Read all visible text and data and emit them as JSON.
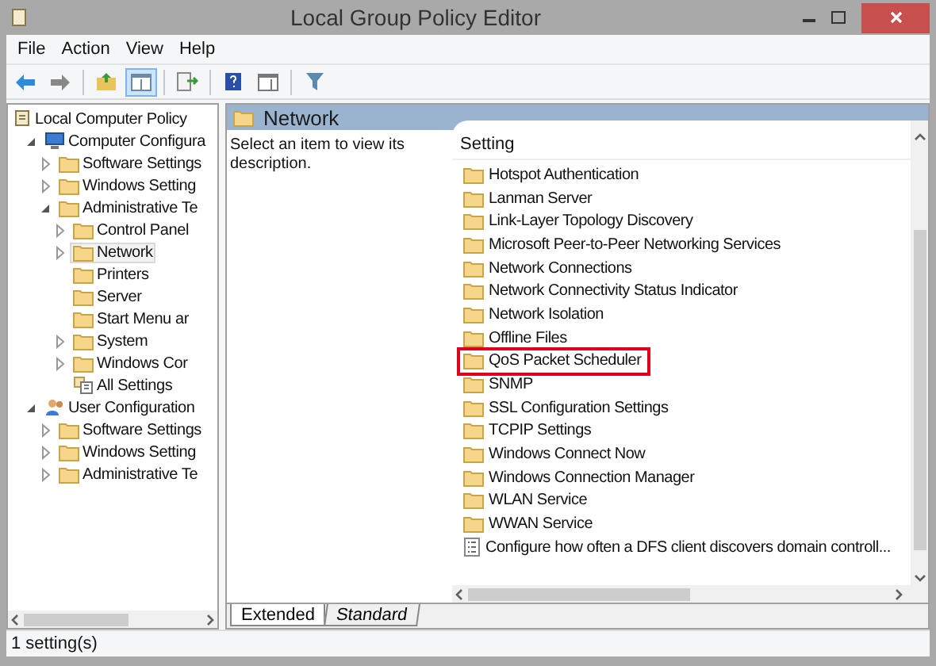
{
  "window": {
    "title": "Local Group Policy Editor"
  },
  "menu": [
    "File",
    "Action",
    "View",
    "Help"
  ],
  "toolbar": [
    {
      "kind": "back",
      "selected": false
    },
    {
      "kind": "forward",
      "selected": false
    },
    {
      "kind": "sep"
    },
    {
      "kind": "up",
      "selected": false
    },
    {
      "kind": "pane",
      "selected": true
    },
    {
      "kind": "sep"
    },
    {
      "kind": "export",
      "selected": false
    },
    {
      "kind": "sep"
    },
    {
      "kind": "help",
      "selected": false
    },
    {
      "kind": "pane2",
      "selected": false
    },
    {
      "kind": "sep"
    },
    {
      "kind": "filter",
      "selected": false
    }
  ],
  "tree": [
    {
      "label": "Local Computer Policy",
      "kind": "policy",
      "selected": false,
      "children": [
        {
          "label": "Computer Configura",
          "kind": "computer",
          "expanded": true,
          "selected": false,
          "children": [
            {
              "label": "Software Settings",
              "kind": "folder",
              "expanded": false,
              "selected": false
            },
            {
              "label": "Windows Setting",
              "kind": "folder",
              "expanded": false,
              "selected": false
            },
            {
              "label": "Administrative Te",
              "kind": "folder",
              "expanded": true,
              "selected": false,
              "children": [
                {
                  "label": "Control Panel",
                  "kind": "folder",
                  "expanded": false,
                  "selected": false
                },
                {
                  "label": "Network",
                  "kind": "folder",
                  "expanded": false,
                  "selected": true
                },
                {
                  "label": "Printers",
                  "kind": "folder",
                  "selected": false
                },
                {
                  "label": "Server",
                  "kind": "folder",
                  "selected": false
                },
                {
                  "label": "Start Menu ar",
                  "kind": "folder",
                  "selected": false
                },
                {
                  "label": "System",
                  "kind": "folder",
                  "expanded": false,
                  "selected": false
                },
                {
                  "label": "Windows Cor",
                  "kind": "folder",
                  "expanded": false,
                  "selected": false
                },
                {
                  "label": "All Settings",
                  "kind": "all-settings",
                  "selected": false
                }
              ]
            }
          ]
        },
        {
          "label": "User Configuration",
          "kind": "user",
          "expanded": true,
          "selected": false,
          "children": [
            {
              "label": "Software Settings",
              "kind": "folder",
              "expanded": false,
              "selected": false
            },
            {
              "label": "Windows Setting",
              "kind": "folder",
              "expanded": false,
              "selected": false
            },
            {
              "label": "Administrative Te",
              "kind": "folder",
              "expanded": false,
              "selected": false
            }
          ]
        }
      ]
    }
  ],
  "content": {
    "title": "Network",
    "description": "Select an item to view its description.",
    "column": "Setting",
    "rows": [
      {
        "label": "Hotspot Authentication",
        "kind": "folder",
        "highlighted": false
      },
      {
        "label": "Lanman Server",
        "kind": "folder",
        "highlighted": false
      },
      {
        "label": "Link-Layer Topology Discovery",
        "kind": "folder",
        "highlighted": false
      },
      {
        "label": "Microsoft Peer-to-Peer Networking Services",
        "kind": "folder",
        "highlighted": false
      },
      {
        "label": "Network Connections",
        "kind": "folder",
        "highlighted": false
      },
      {
        "label": "Network Connectivity Status Indicator",
        "kind": "folder",
        "highlighted": false
      },
      {
        "label": "Network Isolation",
        "kind": "folder",
        "highlighted": false
      },
      {
        "label": "Offline Files",
        "kind": "folder",
        "highlighted": false
      },
      {
        "label": "QoS Packet Scheduler",
        "kind": "folder",
        "highlighted": true
      },
      {
        "label": "SNMP",
        "kind": "folder",
        "highlighted": false
      },
      {
        "label": "SSL Configuration Settings",
        "kind": "folder",
        "highlighted": false
      },
      {
        "label": "TCPIP Settings",
        "kind": "folder",
        "highlighted": false
      },
      {
        "label": "Windows Connect Now",
        "kind": "folder",
        "highlighted": false
      },
      {
        "label": "Windows Connection Manager",
        "kind": "folder",
        "highlighted": false
      },
      {
        "label": "WLAN Service",
        "kind": "folder",
        "highlighted": false
      },
      {
        "label": "WWAN Service",
        "kind": "folder",
        "highlighted": false
      },
      {
        "label": "Configure how often a DFS client discovers domain controll...",
        "kind": "setting",
        "highlighted": false
      }
    ]
  },
  "tabs": [
    {
      "label": "Extended",
      "selected": true
    },
    {
      "label": "Standard",
      "selected": false
    }
  ],
  "status_bar": "1 setting(s)"
}
